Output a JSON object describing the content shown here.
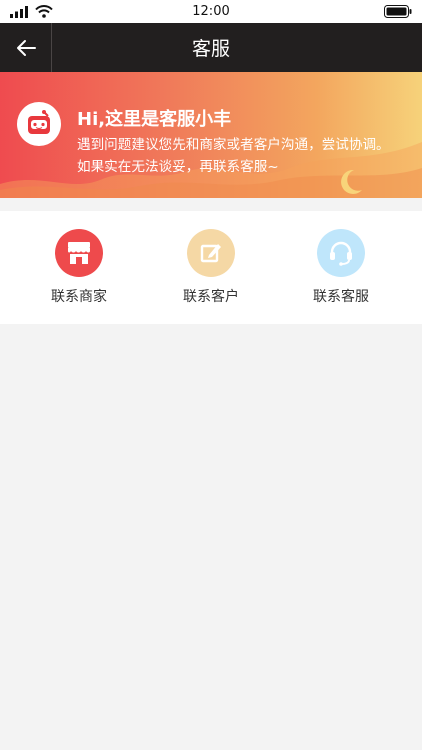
{
  "status_bar": {
    "time": "12:00"
  },
  "header": {
    "title": "客服"
  },
  "banner": {
    "title": "Hi,这里是客服小丰",
    "line1": "遇到问题建议您先和商家或者客户沟通，尝试协调。",
    "line2": "如果实在无法谈妥，再联系客服~"
  },
  "actions": [
    {
      "label": "联系商家",
      "icon": "store-icon",
      "color": "#ee4a4c"
    },
    {
      "label": "联系客户",
      "icon": "edit-icon",
      "color": "#f5d8a5"
    },
    {
      "label": "联系客服",
      "icon": "headset-icon",
      "color": "#bfe6fb"
    }
  ]
}
